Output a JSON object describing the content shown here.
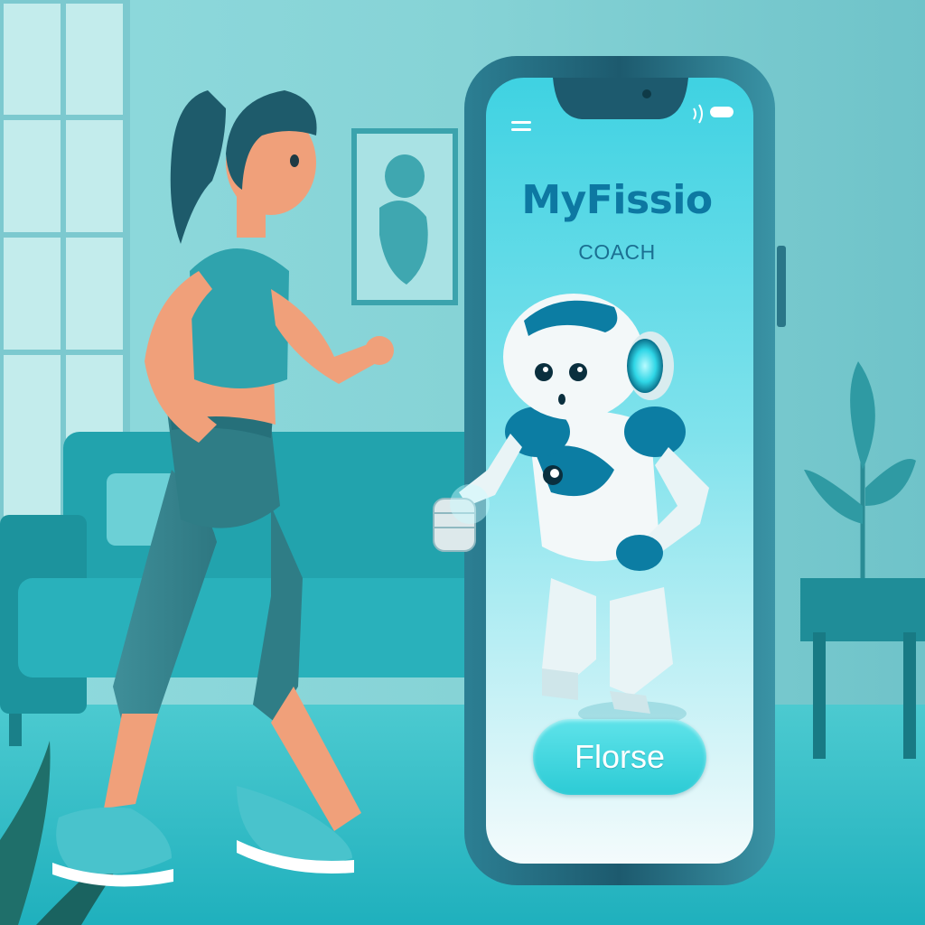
{
  "app": {
    "title": "MyFissio",
    "subtitle": "COACH",
    "cta_label": "Florse"
  },
  "colors": {
    "background": "#8fd8dc",
    "screen": "#3fd2e2",
    "accent": "#0d78a2",
    "button": "#2ccbd5",
    "phone_frame": "#1d5a6e"
  },
  "icons": {
    "status": [
      "menu-icon",
      "camera-dot-icon",
      "signal-icon",
      "battery-icon"
    ]
  }
}
